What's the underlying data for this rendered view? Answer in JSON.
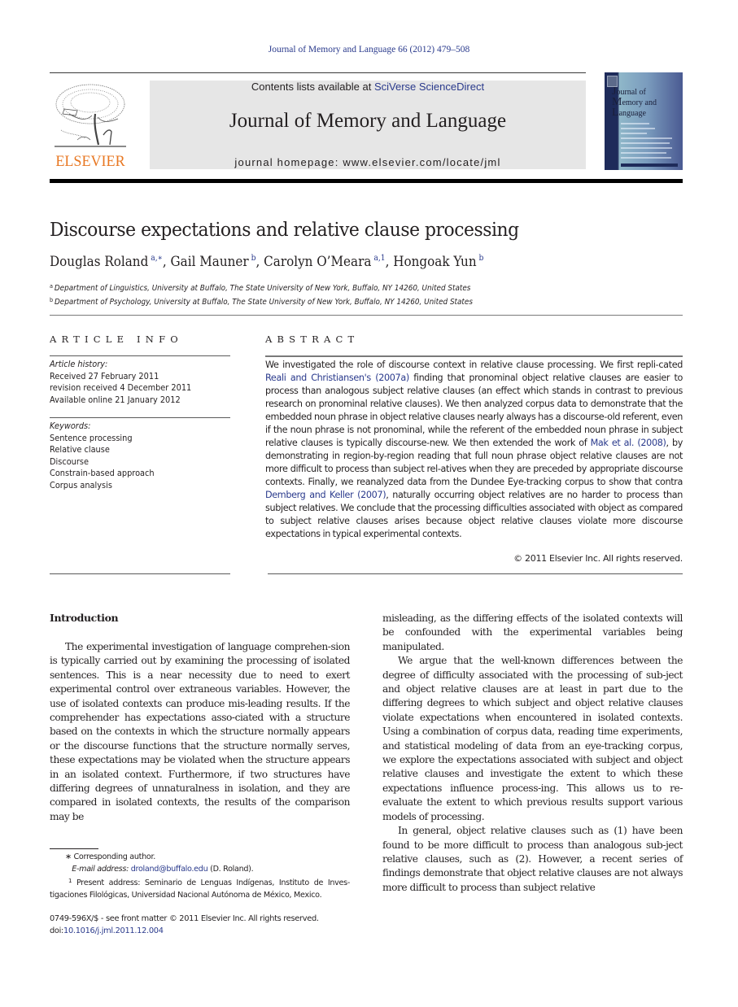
{
  "running_head": "Journal of Memory and Language 66 (2012) 479–508",
  "masthead": {
    "publisher_logo": "ELSEVIER",
    "contents_prefix": "Contents lists available at ",
    "contents_link": "SciVerse ScienceDirect",
    "journal_title": "Journal of Memory and Language",
    "homepage": "journal homepage: www.elsevier.com/locate/jml",
    "cover": {
      "line1_initial": "J",
      "line1_rest": "ournal of",
      "line2_initial": "M",
      "line2_rest": "emory and",
      "line3_initial": "L",
      "line3_rest": "anguage"
    }
  },
  "article": {
    "title": "Discourse expectations and relative clause processing",
    "authors": [
      {
        "name": "Douglas Roland",
        "marks": "a,∗"
      },
      {
        "name": "Gail Mauner",
        "marks": "b"
      },
      {
        "name": "Carolyn O’Meara",
        "marks": "a,1"
      },
      {
        "name": "Hongoak Yun",
        "marks": "b"
      }
    ],
    "affiliations": [
      {
        "mark": "a",
        "text": "Department of Linguistics, University at Buffalo, The State University of New York, Buffalo, NY 14260, United States"
      },
      {
        "mark": "b",
        "text": "Department of Psychology, University at Buffalo, The State University of New York, Buffalo, NY 14260, United States"
      }
    ]
  },
  "article_info": {
    "heading": "ARTICLE INFO",
    "history_label": "Article history:",
    "history": [
      "Received 27 February 2011",
      "revision received 4 December 2011",
      "Available online 21 January 2012"
    ],
    "keywords_label": "Keywords:",
    "keywords": [
      "Sentence processing",
      "Relative clause",
      "Discourse",
      "Constrain-based approach",
      "Corpus analysis"
    ]
  },
  "abstract": {
    "heading": "ABSTRACT",
    "text_1": "We investigated the role of discourse context in relative clause processing. We first repli-cated ",
    "link_1": "Reali and Christiansen's (2007a)",
    "text_2": " finding that pronominal object relative clauses are easier to process than analogous subject relative clauses (an effect which stands in contrast to previous research on pronominal relative clauses). We then analyzed corpus data to demonstrate that the embedded noun phrase in object relative clauses nearly always has a discourse-old referent, even if the noun phrase is not pronominal, while the referent of the embedded noun phrase in subject relative clauses is typically discourse-new. We then extended the work of ",
    "link_2": "Mak et al. (2008)",
    "text_3": ", by demonstrating in region-by-region reading that full noun phrase object relative clauses are not more difficult to process than subject rel-atives when they are preceded by appropriate discourse contexts. Finally, we reanalyzed data from the Dundee Eye-tracking corpus to show that contra ",
    "link_3": "Demberg and Keller (2007)",
    "text_4": ", naturally occurring object relatives are no harder to process than subject relatives. We conclude that the processing difficulties associated with object as compared to subject relative clauses arises because object relative clauses violate more discourse expectations in typical experimental contexts.",
    "copyright": "© 2011 Elsevier Inc. All rights reserved."
  },
  "body": {
    "section_heading": "Introduction",
    "left_paragraph": "The experimental investigation of language comprehen-sion is typically carried out by examining the processing of isolated sentences. This is a near necessity due to need to exert experimental control over extraneous variables. However, the use of isolated contexts can produce mis-leading results. If the comprehender has expectations asso-ciated with a structure based on the contexts in which the structure normally appears or the discourse functions that the structure normally serves, these expectations may be violated when the structure appears in an isolated context. Furthermore, if two structures have differing degrees of unnaturalness in isolation, and they are compared in isolated contexts, the results of the comparison may be",
    "right_continuation": "misleading, as the differing effects of the isolated contexts will be confounded with the experimental variables being manipulated.",
    "right_paragraph_2": "We argue that the well-known differences between the degree of difficulty associated with the processing of sub-ject and object relative clauses are at least in part due to the differing degrees to which subject and object relative clauses violate expectations when encountered in isolated contexts. Using a combination of corpus data, reading time experiments, and statistical modeling of data from an eye-tracking corpus, we explore the expectations associated with subject and object relative clauses and investigate the extent to which these expectations influence process-ing. This allows us to re-evaluate the extent to which previous results support various models of processing.",
    "right_paragraph_3": "In general, object relative clauses such as (1) have been found to be more difficult to process than analogous sub-ject relative clauses, such as (2). However, a recent series of findings demonstrate that object relative clauses are not always more difficult to process than subject relative"
  },
  "footnotes": {
    "corresponding_mark": "∗",
    "corresponding": "Corresponding author.",
    "email_label": "E-mail address:",
    "email": "droland@buffalo.edu",
    "email_suffix": " (D. Roland).",
    "fn1_mark": "1",
    "fn1": "Present address: Seminario de Lenguas Indígenas, Instituto de Inves-tigaciones Filológicas, Universidad Nacional Autónoma de México, Mexico.",
    "issn": "0749-596X/$ - see front matter © 2011 Elsevier Inc. All rights reserved.",
    "doi_label": "doi:",
    "doi": "10.1016/j.jml.2011.12.004"
  },
  "colors": {
    "link": "#2a3a8c",
    "elsevier_orange": "#e87722",
    "banner_bg": "#e6e6e6"
  }
}
